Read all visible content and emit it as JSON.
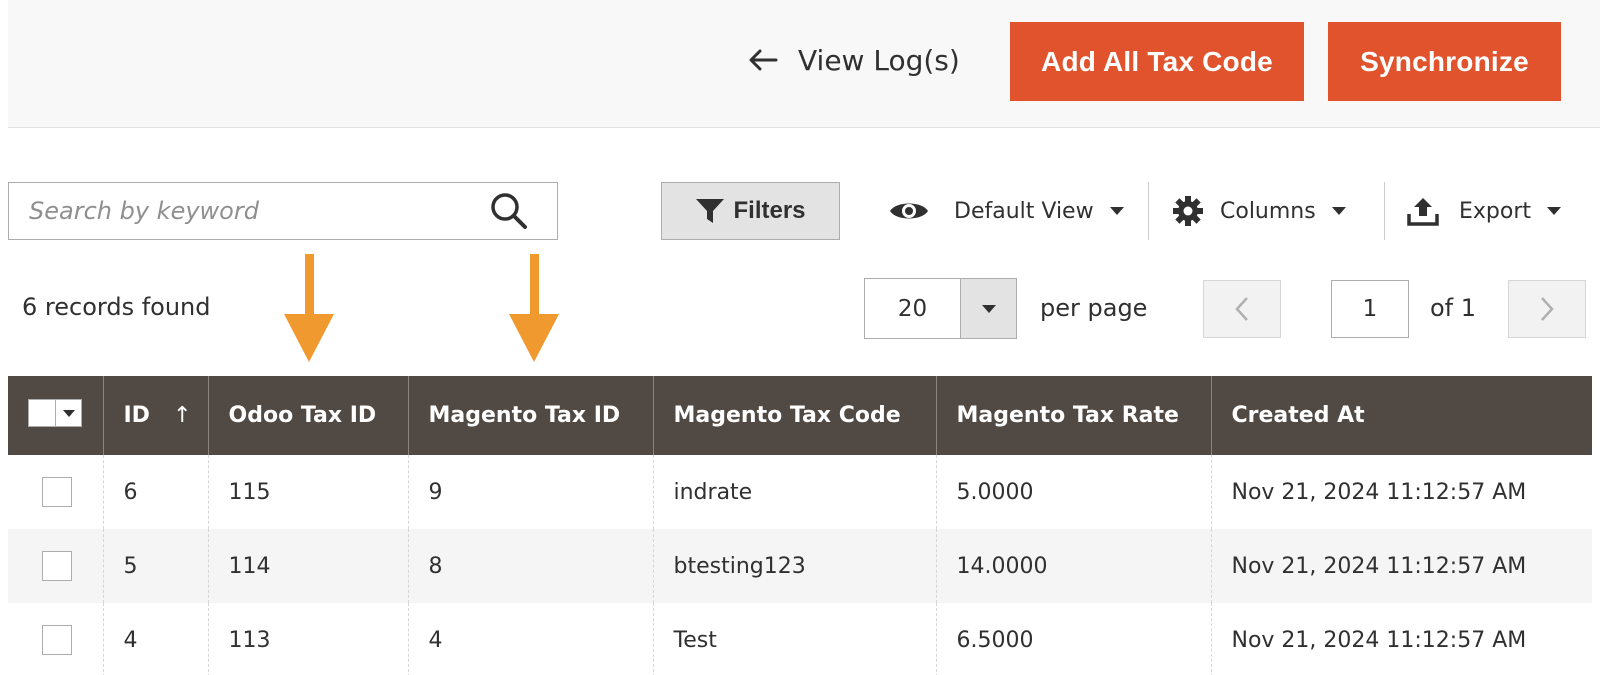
{
  "header": {
    "back_label": "View Log(s)",
    "add_all_label": "Add All Tax Code",
    "sync_label": "Synchronize"
  },
  "search": {
    "placeholder": "Search by keyword"
  },
  "toolbar": {
    "filters_label": "Filters",
    "view_label": "Default View",
    "columns_label": "Columns",
    "export_label": "Export"
  },
  "records_found": "6 records found",
  "pager": {
    "per_page_value": "20",
    "per_page_label": "per page",
    "current_page": "1",
    "of_pages": "of 1"
  },
  "table": {
    "columns": [
      "ID",
      "Odoo Tax ID",
      "Magento Tax ID",
      "Magento Tax Code",
      "Magento Tax Rate",
      "Created At"
    ],
    "sort_indicator": "↑",
    "rows": [
      [
        "6",
        "115",
        "9",
        "indrate",
        "5.0000",
        "Nov 21, 2024 11:12:57 AM"
      ],
      [
        "5",
        "114",
        "8",
        "btesting123",
        "14.0000",
        "Nov 21, 2024 11:12:57 AM"
      ],
      [
        "4",
        "113",
        "4",
        "Test",
        "6.5000",
        "Nov 21, 2024 11:12:57 AM"
      ]
    ]
  },
  "colors": {
    "primary_button": "#e0532c",
    "table_header": "#514943",
    "annotation_arrow": "#f0992e"
  }
}
